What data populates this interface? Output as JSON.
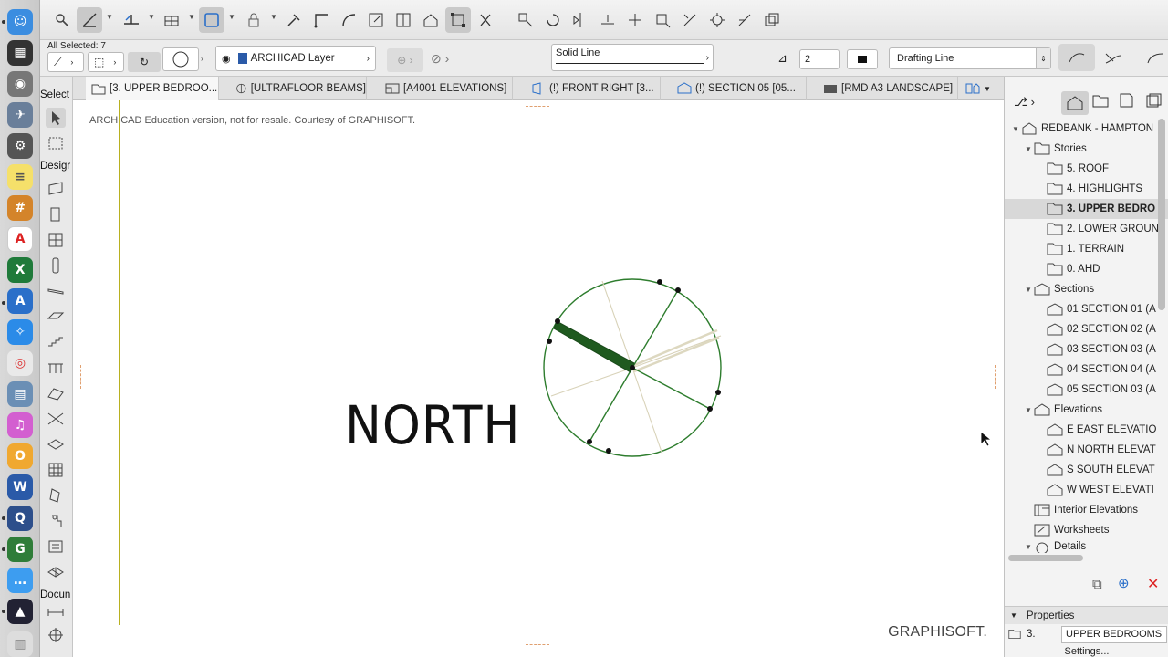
{
  "toolbar2": {
    "all_selected_label": "All Selected: 7",
    "layer_label": "ARCHICAD Layer",
    "line_type": "Solid Line",
    "pen_number": "2",
    "line_category": "Drafting Line"
  },
  "toolbox": {
    "select_label": "Select",
    "design_label": "Desigr",
    "document_label": "Docun"
  },
  "tabs": [
    {
      "label": "[3. UPPER BEDROO..."
    },
    {
      "label": "[ULTRAFLOOR BEAMS]"
    },
    {
      "label": "[A4001 ELEVATIONS]"
    },
    {
      "label": "(!) FRONT RIGHT [3..."
    },
    {
      "label": "(!) SECTION 05 [05..."
    },
    {
      "label": "[RMD A3 LANDSCAPE]"
    }
  ],
  "canvas": {
    "edu_note": "ARCHICAD Education version, not for resale. Courtesy of GRAPHISOFT.",
    "north_label": "NORTH",
    "brand": "GRAPHISOFT."
  },
  "navigator": {
    "project": "REDBANK - HAMPTON",
    "stories_label": "Stories",
    "stories": [
      "5. ROOF",
      "4. HIGHLIGHTS",
      "3. UPPER BEDRO",
      "2. LOWER GROUN",
      "1. TERRAIN",
      "0. AHD"
    ],
    "sections_label": "Sections",
    "sections": [
      "01 SECTION 01 (A",
      "02 SECTION 02 (A",
      "03 SECTION 03 (A",
      "04 SECTION 04 (A",
      "05 SECTION 03 (A"
    ],
    "elevations_label": "Elevations",
    "elevations": [
      "E EAST ELEVATIO",
      "N NORTH ELEVAT",
      "S SOUTH ELEVAT",
      "W WEST ELEVATI"
    ],
    "interior_label": "Interior Elevations",
    "worksheets_label": "Worksheets",
    "details_label": "Details",
    "properties_label": "Properties",
    "prop_id": "3.",
    "prop_name": "UPPER BEDROOMS",
    "settings_label": "Settings..."
  },
  "colors": {
    "accent_green": "#2e7d2e",
    "selection_gray": "#d8d8d8"
  }
}
